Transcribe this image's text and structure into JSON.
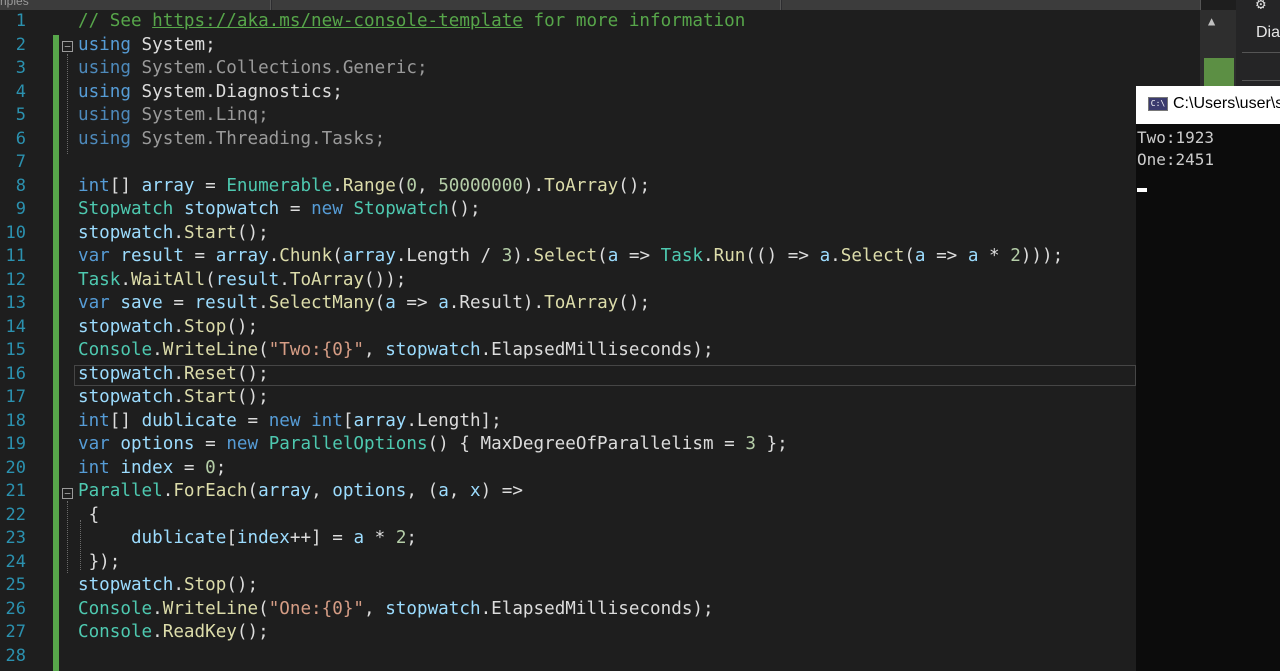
{
  "top_tab_label": "nples",
  "line_numbers": [
    "1",
    "2",
    "3",
    "4",
    "5",
    "6",
    "7",
    "8",
    "9",
    "10",
    "11",
    "12",
    "13",
    "14",
    "15",
    "16",
    "17",
    "18",
    "19",
    "20",
    "21",
    "22",
    "23",
    "24",
    "25",
    "26",
    "27",
    "28"
  ],
  "code": {
    "comment_prefix": "// See ",
    "comment_link": "https://aka.ms/new-console-template",
    "comment_suffix": " for more information",
    "kw_using": "using",
    "ns_system": " System;",
    "ns_collections": " System.Collections.Generic;",
    "ns_diagnostics": " System.Diagnostics;",
    "ns_linq": " System.Linq;",
    "ns_tasks": " System.Threading.Tasks;"
  },
  "right_panel": {
    "title_fragment": "Dia"
  },
  "console": {
    "title": "C:\\Users\\user\\s",
    "icon_label": "C:\\",
    "output": [
      "Two:1923",
      "One:2451"
    ]
  },
  "colors": {
    "editor_bg": "#1e1e1e",
    "keyword": "#569cd6",
    "type": "#4ec9b0",
    "method": "#dcdcaa",
    "variable": "#9cdcfe",
    "number": "#b5cea8",
    "string": "#d69d85",
    "comment": "#57a64a",
    "line_number": "#2b91af",
    "change_bar": "#57a64a",
    "console_bg": "#0c0c0c"
  }
}
